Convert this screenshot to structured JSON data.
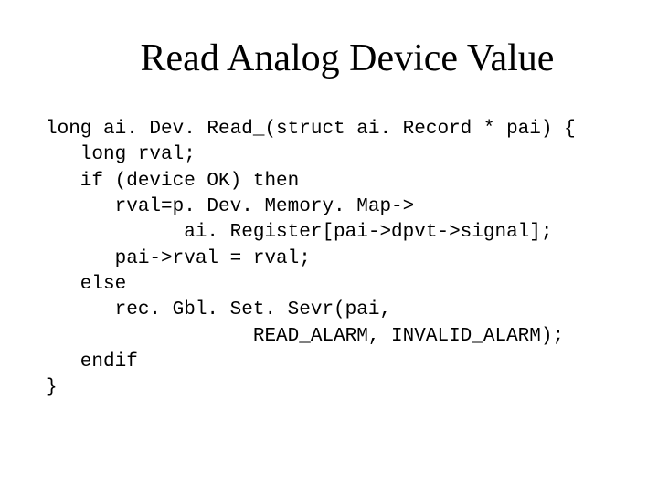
{
  "title": "Read Analog Device Value",
  "code": {
    "l1": "long ai. Dev. Read_(struct ai. Record * pai) {",
    "l2": "   long rval;",
    "l3": "   if (device OK) then",
    "l4": "      rval=p. Dev. Memory. Map->",
    "l5": "            ai. Register[pai->dpvt->signal];",
    "l6": "      pai->rval = rval;",
    "l7": "   else",
    "l8": "      rec. Gbl. Set. Sevr(pai,",
    "l9": "                  READ_ALARM, INVALID_ALARM);",
    "l10": "   endif",
    "l11": "}"
  }
}
